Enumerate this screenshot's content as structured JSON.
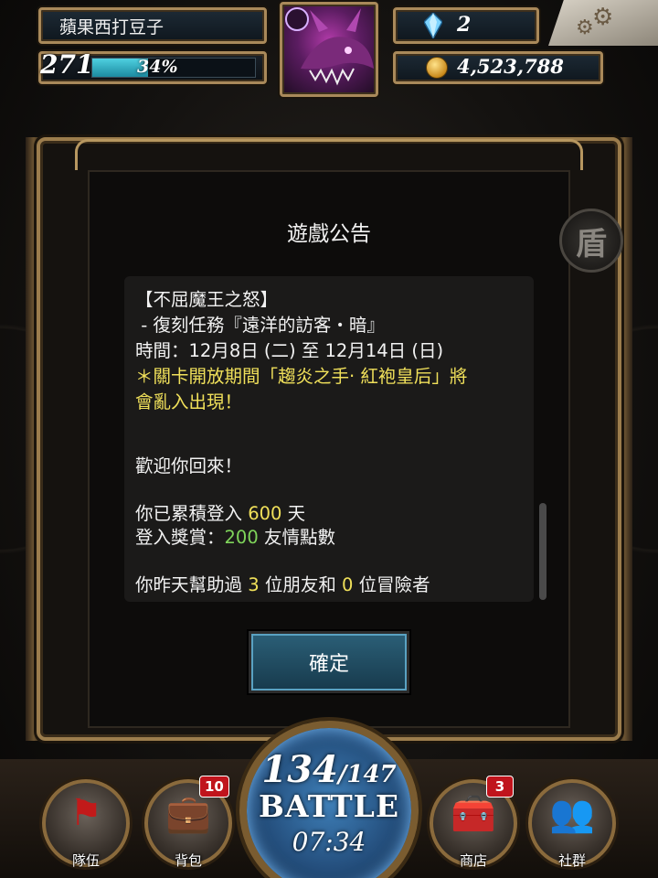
{
  "player": {
    "name": "蘋果西打豆子",
    "level": "271",
    "exp_percent_label": "34%",
    "exp_fraction": 0.34
  },
  "currency": {
    "gems": "2",
    "coins": "4,523,788"
  },
  "dialog": {
    "title": "遊戲公告",
    "lines": {
      "l1": "【不屈魔王之怒】",
      "l2": " - 復刻任務『遠洋的訪客・暗』",
      "l3": "時間：12月8日 (二) 至 12月14日 (日)",
      "l4": "＊關卡開放期間「趨炎之手‧ 紅袍皇后」將",
      "l5": "會亂入出現！",
      "l6": "歡迎你回來！",
      "l7_pre": "你已累積登入 ",
      "l7_num": "600",
      "l7_post": " 天",
      "l8_pre": "登入獎賞：",
      "l8_num": "200",
      "l8_post": " 友情點數",
      "l9_pre": "你昨天幫助過 ",
      "l9_num1": "3",
      "l9_mid": " 位朋友和 ",
      "l9_num2": "0",
      "l9_post": " 位冒險者"
    },
    "confirm_label": "確定",
    "side_tab_glyph": "盾"
  },
  "battle": {
    "current": "134",
    "max": "/147",
    "label": "BATTLE",
    "timer": "07:34"
  },
  "nav": {
    "team": {
      "label": "隊伍",
      "icon": "flag-icon"
    },
    "bag": {
      "label": "背包",
      "icon": "briefcase-icon",
      "badge": "10"
    },
    "shop": {
      "label": "商店",
      "icon": "treasure-chest-icon",
      "badge": "3"
    },
    "social": {
      "label": "社群",
      "icon": "people-icon"
    }
  },
  "colors": {
    "highlight_yellow": "#f0e05a",
    "highlight_green": "#7fd45a",
    "gold_frame": "#a9895a",
    "badge_red": "#c0141c",
    "button_blue": "#2b5f77"
  }
}
